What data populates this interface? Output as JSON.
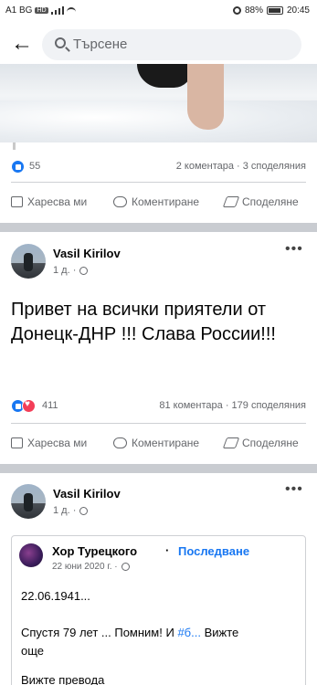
{
  "status": {
    "carrier": "A1 BG",
    "net": "HD",
    "battery": "88%",
    "time": "20:45"
  },
  "search": {
    "placeholder": "Търсене"
  },
  "post1": {
    "reaction_count": "55",
    "meta": "2 коментара · 3 споделяния"
  },
  "actions": {
    "like": "Харесва ми",
    "comment": "Коментиране",
    "share": "Споделяне"
  },
  "post2": {
    "author": "Vasil Kirilov",
    "time": "1 д. ·",
    "text": "Привет на всички приятели от Донецк-ДНР !!!  Слава России!!!",
    "reaction_count": "411",
    "meta": "81 коментара · 179 споделяния"
  },
  "post3": {
    "author": "Vasil Kirilov",
    "time": "1 д. ·",
    "shared": {
      "author": "Хор Турецкого",
      "dot": "·",
      "follow": "Последване",
      "time": "22 юни 2020 г. ·",
      "line1": "22.06.1941...",
      "line2_prefix": "Спустя 79 лет ... Помним! И ",
      "hashtag": "#б...",
      "see_more": " Вижте",
      "line3": "още",
      "see_translation": "Вижте превода"
    }
  }
}
